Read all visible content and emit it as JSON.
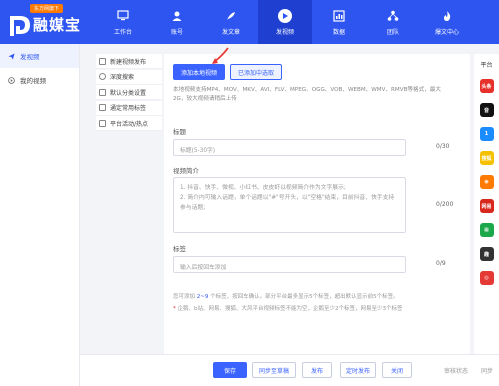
{
  "brand": {
    "badge": "东方网旗下",
    "name": "融媒宝"
  },
  "nav": {
    "items": [
      {
        "label": "工作台",
        "icon": "monitor-icon"
      },
      {
        "label": "账号",
        "icon": "user-icon"
      },
      {
        "label": "发文章",
        "icon": "feather-icon"
      },
      {
        "label": "发视频",
        "icon": "play-icon"
      },
      {
        "label": "数据",
        "icon": "chart-icon"
      },
      {
        "label": "团队",
        "icon": "team-icon"
      },
      {
        "label": "爆文中心",
        "icon": "flame-icon"
      }
    ],
    "active_index": 3
  },
  "sidebar": {
    "items": [
      {
        "label": "发视频"
      },
      {
        "label": "我的视频"
      }
    ]
  },
  "submenu": {
    "items": [
      {
        "label": "新建视频发布"
      },
      {
        "label": "深度搜索"
      },
      {
        "label": "默认分类设置"
      },
      {
        "label": "通定常用标签"
      },
      {
        "label": "平台活动/热点"
      }
    ]
  },
  "form": {
    "upload_button": "添加本地视频",
    "pick_button": "已添加中选取",
    "support_note": "本地视频支持MP4、MOV、MKV、AVI、FLV、MPEG、OGG、VOB、WEBM、WMV、RMVB等格式，最大2G，较大视频请稍后上传",
    "title_label": "标题",
    "title_placeholder": "标题(5-30字)",
    "title_counter": "0/30",
    "desc_label": "视频简介",
    "desc_placeholder_1": "1. 抖音、快手、微视、小红书、皮皮虾以视频简介作为文字展示;",
    "desc_placeholder_2": "2. 简介内可输入话题，单个话题以\"#\"号开头，以\"空格\"结束，目前抖音、快手支持参与话题;",
    "desc_counter": "0/200",
    "tags_label": "标签",
    "tags_placeholder": "输入后按回车添加",
    "tags_counter": "0/9",
    "tip1_pre": "您可添加",
    "tip1_num": "2~9",
    "tip1_post": "个标签，按回车确认。部分平台最多显示5个标签，超出默认显示前5个标签。",
    "tip2_mark": "*",
    "tip2_text": "企鹅、b站、网易、搜狐、大风平台视频标签不能为空，企鹅至少2个标签，网易至少3个标签"
  },
  "actions": {
    "save": "保存",
    "sync_draft": "同步至草稿",
    "publish": "发布",
    "scheduled": "定时发布",
    "close": "关闭",
    "review_status": "审核状态",
    "sync": "同步"
  },
  "platforms": {
    "title": "平台",
    "items": [
      {
        "label": "头条",
        "color": "#e8302a"
      },
      {
        "label": "音",
        "color": "#111111"
      },
      {
        "label": "1",
        "color": "#1a8cff"
      },
      {
        "label": "搜狐",
        "color": "#f5c000"
      },
      {
        "label": "◉",
        "color": "#ff7a00"
      },
      {
        "label": "网易",
        "color": "#d8271c"
      },
      {
        "label": "▦",
        "color": "#1aa84a"
      },
      {
        "label": "趣",
        "color": "#333333"
      },
      {
        "label": "◎",
        "color": "#e53935"
      }
    ]
  }
}
